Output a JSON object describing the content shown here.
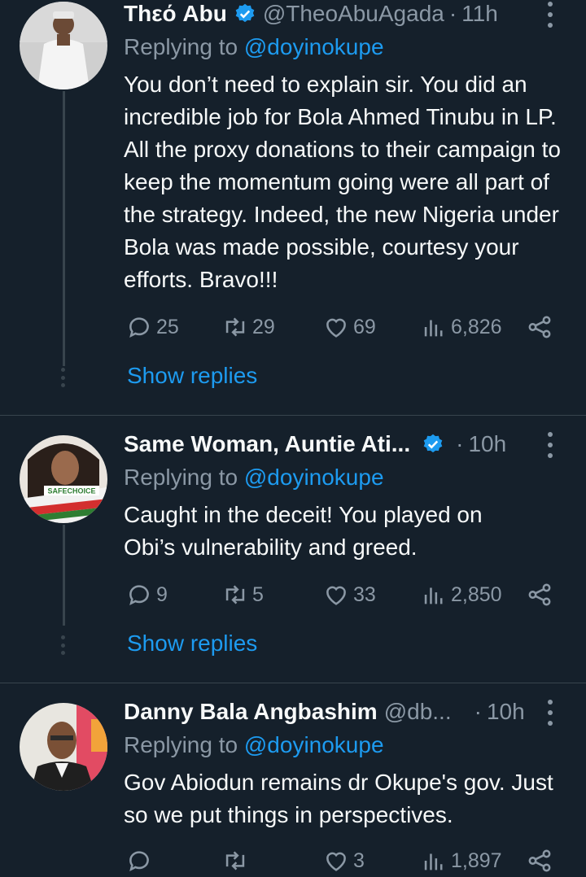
{
  "tweets": [
    {
      "name": "Thεό Abu",
      "handle": "@TheoAbuAgada",
      "time": "11h",
      "replying_prefix": "Replying to",
      "replying_to": "@doyinokupe",
      "text": "You don’t need to explain sir. You did an incredible job for Bola Ahmed Tinubu in LP. All the proxy donations to their campaign to keep the momentum going were all part of the strategy. Indeed, the new Nigeria under Bola was made possible, courtesy your efforts. Bravo!!!",
      "replies": "25",
      "retweets": "29",
      "likes": "69",
      "views": "6,826",
      "show_replies": "Show replies"
    },
    {
      "name": "Same Woman, Auntie Ati...",
      "handle": "",
      "time": "10h",
      "replying_prefix": "Replying to",
      "replying_to": "@doyinokupe",
      "text": "Caught in the deceit! You played on Obi’s vulnerability and greed.",
      "replies": "9",
      "retweets": "5",
      "likes": "33",
      "views": "2,850",
      "show_replies": "Show replies",
      "avatar_text": "SAFECHOICE"
    },
    {
      "name": "Danny Bala Angbashim",
      "handle": "@db...",
      "time": "10h",
      "replying_prefix": "Replying to",
      "replying_to": "@doyinokupe",
      "text": "Gov Abiodun remains dr Okupe's gov. Just so we put things in perspectives.",
      "replies": "",
      "retweets": "",
      "likes": "3",
      "views": "1,897"
    }
  ],
  "colors": {
    "background": "#15202b",
    "accent": "#1d9bf0",
    "secondary_text": "#8b98a5",
    "divider": "#38444d"
  },
  "icons": [
    "verified-badge-icon",
    "more-icon",
    "reply-icon",
    "retweet-icon",
    "like-icon",
    "views-icon",
    "share-icon"
  ]
}
